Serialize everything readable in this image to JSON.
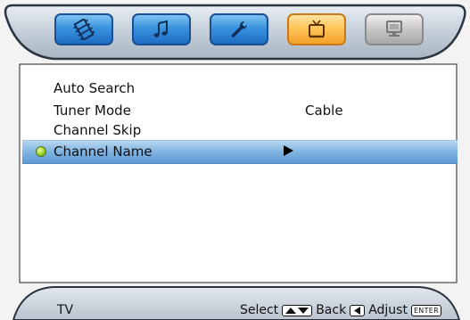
{
  "tabs": [
    {
      "name": "picture",
      "icon": "film-icon",
      "selected": false
    },
    {
      "name": "sound",
      "icon": "music-note-icon",
      "selected": false
    },
    {
      "name": "setup",
      "icon": "wrench-icon",
      "selected": false
    },
    {
      "name": "tv",
      "icon": "tv-icon",
      "selected": true
    },
    {
      "name": "pc",
      "icon": "monitor-icon",
      "selected": false
    }
  ],
  "menu": {
    "items": [
      {
        "label": "Auto Search",
        "value": ""
      },
      {
        "label": "Tuner Mode",
        "value": "Cable"
      },
      {
        "label": "Channel Skip",
        "value": ""
      },
      {
        "label": "Channel Name",
        "value": ""
      }
    ],
    "selected_index": 3
  },
  "footer": {
    "title": "TV",
    "select_label": "Select",
    "back_label": "Back",
    "adjust_label": "Adjust",
    "enter_key_label": "ENTER"
  },
  "colors": {
    "tab_blue": "#3a93de",
    "tab_selected": "#ffc45a",
    "tab_disabled": "#c6c6c6",
    "highlight": "#7fb3e0",
    "frame": "#b8c4d0",
    "bullet": "#a9d83a"
  }
}
